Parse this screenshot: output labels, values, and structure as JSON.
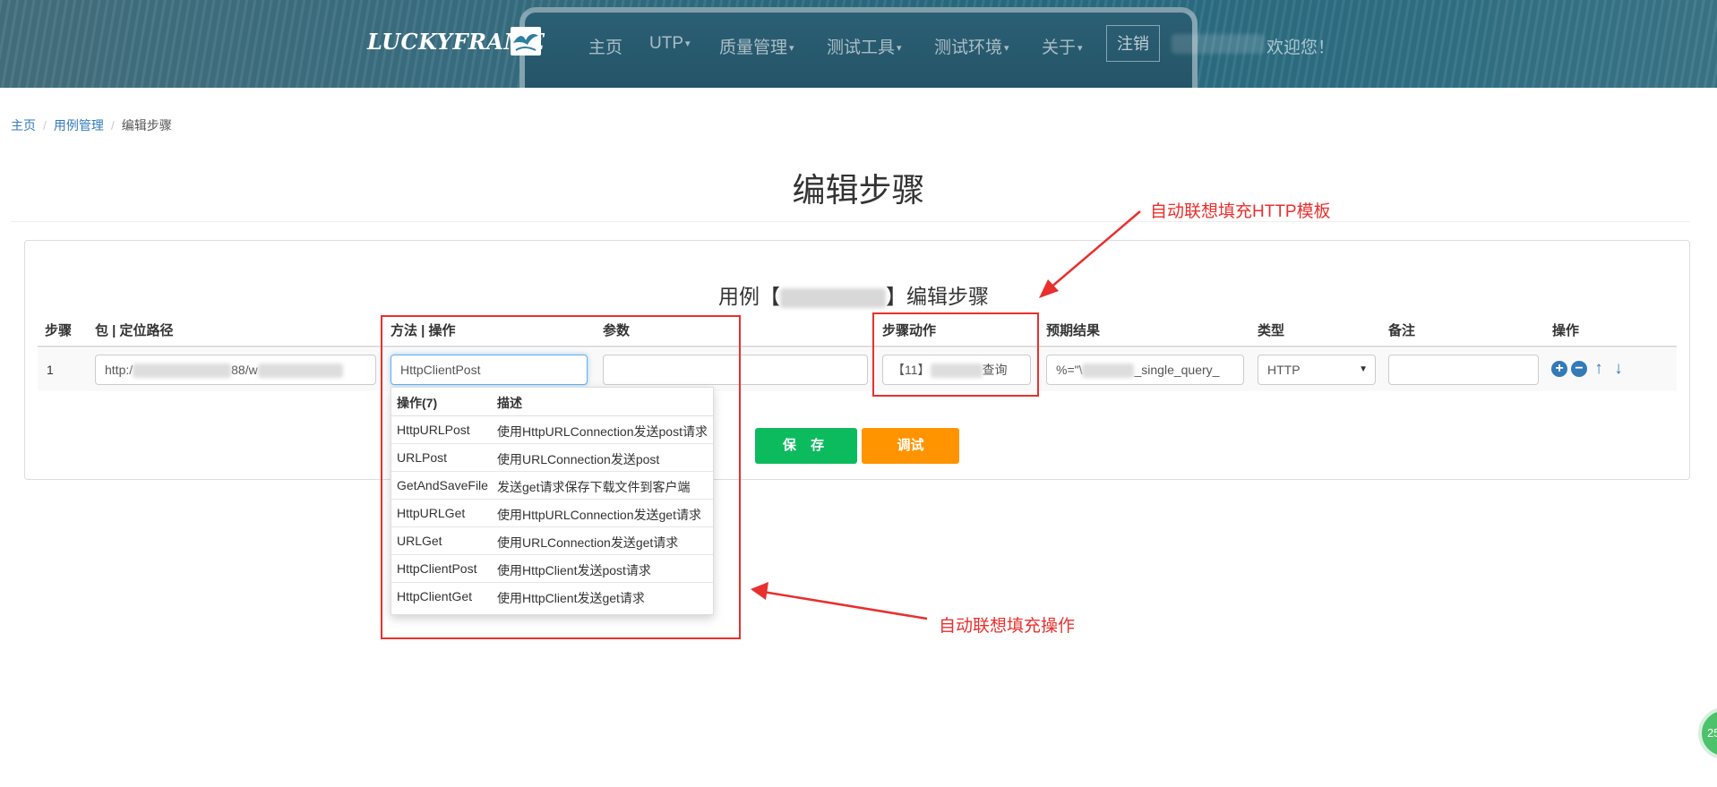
{
  "header": {
    "logo_text": "LUCKYFRAME",
    "nav": [
      {
        "label": "主页",
        "dropdown": false
      },
      {
        "label": "UTP",
        "dropdown": true
      },
      {
        "label": "质量管理",
        "dropdown": true
      },
      {
        "label": "测试工具",
        "dropdown": true
      },
      {
        "label": "测试环境",
        "dropdown": true
      },
      {
        "label": "关于",
        "dropdown": true
      }
    ],
    "logout_label": "注销",
    "welcome": "欢迎您！"
  },
  "breadcrumb": [
    "主页",
    "用例管理",
    "编辑步骤"
  ],
  "page_title": "编辑步骤",
  "case_title": {
    "prefix": "用例【",
    "suffix": "】编辑步骤"
  },
  "table": {
    "headers": [
      "步骤",
      "包 | 定位路径",
      "方法 | 操作",
      "参数",
      "步骤动作",
      "预期结果",
      "类型",
      "备注",
      "操作"
    ],
    "row": {
      "step": "1",
      "path_prefix": "http:/",
      "path_mid": "88/w",
      "method": "HttpClientPost",
      "params": "",
      "action_prefix": "【11】",
      "action_suffix": "查询",
      "expected_prefix": "%=\"\\",
      "expected_suffix": "_single_query_",
      "type": "HTTP",
      "remark": ""
    }
  },
  "dropdown": {
    "headers": [
      "操作(7)",
      "描述"
    ],
    "items": [
      {
        "op": "HttpURLPost",
        "desc": "使用HttpURLConnection发送post请求"
      },
      {
        "op": "URLPost",
        "desc": "使用URLConnection发送post"
      },
      {
        "op": "GetAndSaveFile",
        "desc": "发送get请求保存下载文件到客户端"
      },
      {
        "op": "HttpURLGet",
        "desc": "使用HttpURLConnection发送get请求"
      },
      {
        "op": "URLGet",
        "desc": "使用URLConnection发送get请求"
      },
      {
        "op": "HttpClientPost",
        "desc": "使用HttpClient发送post请求"
      },
      {
        "op": "HttpClientGet",
        "desc": "使用HttpClient发送get请求"
      }
    ]
  },
  "buttons": {
    "save": "保 存",
    "debug": "调试"
  },
  "annotations": {
    "http_template": "自动联想填充HTTP模板",
    "operation": "自动联想填充操作"
  },
  "badge": "25",
  "colors": {
    "annotation_red": "#e8302e",
    "save_green": "#0dbb5f",
    "debug_orange": "#ff9400",
    "link_blue": "#337ab7"
  }
}
